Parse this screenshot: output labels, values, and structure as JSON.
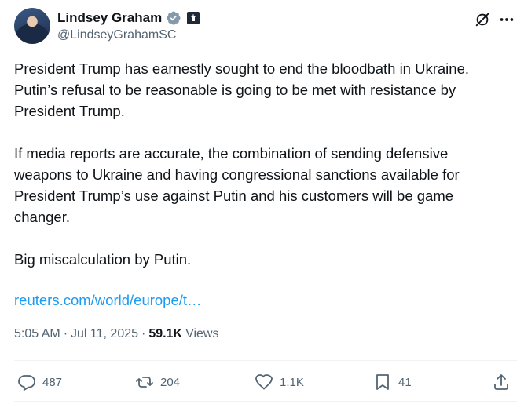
{
  "author": {
    "name": "Lindsey Graham",
    "handle": "@LindseyGrahamSC"
  },
  "tweet": {
    "paragraph1": "President Trump has earnestly sought to end the bloodbath in Ukraine. Putin’s refusal to be reasonable is going to be met with resistance by President Trump.",
    "paragraph2": "If media reports are accurate, the combination of sending defensive weapons to Ukraine and having congressional sanctions available for President Trump’s use against Putin and his customers will be game changer.",
    "paragraph3": "Big miscalculation by Putin.",
    "link": "reuters.com/world/europe/t…"
  },
  "meta": {
    "time": "5:05 AM",
    "separator": "·",
    "date": "Jul 11, 2025",
    "separator2": "·",
    "views_count": "59.1K",
    "views_label": "Views"
  },
  "actions": {
    "replies": "487",
    "reposts": "204",
    "likes": "1.1K",
    "bookmarks": "41"
  },
  "colors": {
    "link": "#1d9bf0",
    "verified": "#829aab",
    "secondary_text": "#536471"
  },
  "icons": [
    "verified-badge-icon",
    "government-badge-icon",
    "grok-icon",
    "more-icon",
    "reply-icon",
    "repost-icon",
    "like-icon",
    "bookmark-icon",
    "share-icon"
  ]
}
